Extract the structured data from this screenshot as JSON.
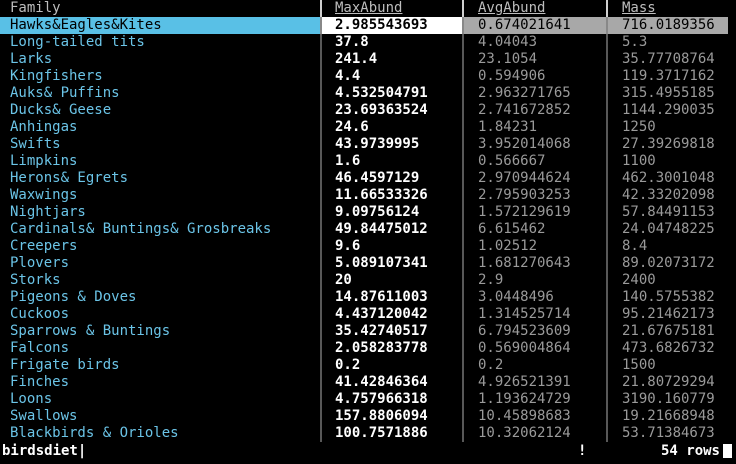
{
  "table": {
    "columns": [
      "Family",
      "MaxAbund",
      "AvgAbund",
      "Mass"
    ],
    "rows": [
      [
        "Hawks&Eagles&Kites",
        "2.985543693",
        "0.674021641",
        "716.0189356"
      ],
      [
        "Long-tailed tits",
        "37.8",
        "4.04043",
        "5.3"
      ],
      [
        "Larks",
        "241.4",
        "23.1054",
        "35.77708764"
      ],
      [
        "Kingfishers",
        "4.4",
        "0.594906",
        "119.3717162"
      ],
      [
        "Auks& Puffins",
        "4.532504791",
        "2.963271765",
        "315.4955185"
      ],
      [
        "Ducks& Geese",
        "23.69363524",
        "2.741672852",
        "1144.290035"
      ],
      [
        "Anhingas",
        "24.6",
        "1.84231",
        "1250"
      ],
      [
        "Swifts",
        "43.9739995",
        "3.952014068",
        "27.39269818"
      ],
      [
        "Limpkins",
        "1.6",
        "0.566667",
        "1100"
      ],
      [
        "Herons& Egrets",
        "46.4597129",
        "2.970944624",
        "462.3001048"
      ],
      [
        "Waxwings",
        "11.66533326",
        "2.795903253",
        "42.33202098"
      ],
      [
        "Nightjars",
        "9.09756124",
        "1.572129619",
        "57.84491153"
      ],
      [
        "Cardinals& Buntings& Grosbreaks",
        "49.84475012",
        "6.615462",
        "24.04748225"
      ],
      [
        "Creepers",
        "9.6",
        "1.02512",
        "8.4"
      ],
      [
        "Plovers",
        "5.089107341",
        "1.681270643",
        "89.02073172"
      ],
      [
        "Storks",
        "20",
        "2.9",
        "2400"
      ],
      [
        "Pigeons & Doves",
        "14.87611003",
        "3.0448496",
        "140.5755382"
      ],
      [
        "Cuckoos",
        "4.437120042",
        "1.314525714",
        "95.21462173"
      ],
      [
        "Sparrows & Buntings",
        "35.42740517",
        "6.794523609",
        "21.67675181"
      ],
      [
        "Falcons",
        "2.058283778",
        "0.569004864",
        "473.6826732"
      ],
      [
        "Frigate birds",
        "0.2",
        "0.2",
        "1500"
      ],
      [
        "Finches",
        "41.42846364",
        "4.926521391",
        "21.80729294"
      ],
      [
        "Loons",
        "4.757966318",
        "1.193624729",
        "3190.160779"
      ],
      [
        "Swallows",
        "157.8806094",
        "10.45898683",
        "19.21668948"
      ],
      [
        "Blackbirds & Orioles",
        "100.7571886",
        "10.32062124",
        "53.71384673"
      ]
    ],
    "selected_row": 0
  },
  "status": {
    "command": "birdsdiet|",
    "mark": "!",
    "row_count": "54 rows"
  },
  "colors": {
    "background": "#000000",
    "family_text": "#6bc4e7",
    "selection_name": "#59c0e6",
    "selection_value": "#ffffff",
    "selection_rest": "#a8a8a8"
  }
}
